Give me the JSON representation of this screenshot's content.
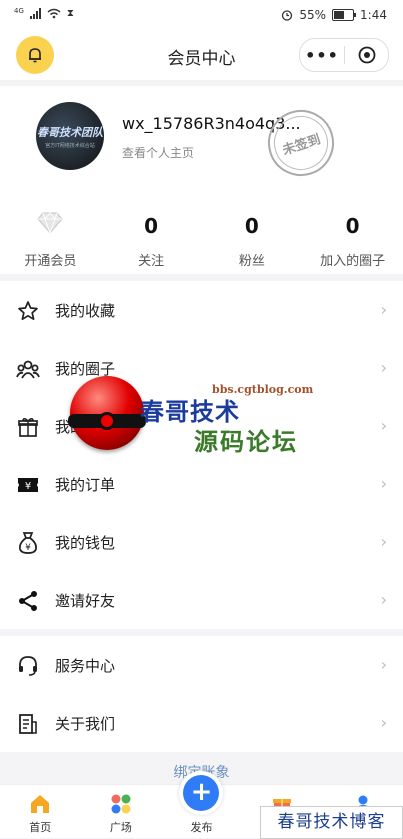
{
  "status_bar": {
    "network": "4G",
    "battery": "55%",
    "time": "1:44"
  },
  "nav": {
    "title": "会员中心",
    "more_label": "•••"
  },
  "profile": {
    "username": "wx_15786R3n4o4q3...",
    "view_profile": "查看个人主页",
    "avatar_text": "春哥技术团队",
    "avatar_subtext": "官方IT网络技术综合站",
    "checkin_stamp": "未签到"
  },
  "stats": [
    {
      "label": "开通会员"
    },
    {
      "value": "0",
      "label": "关注"
    },
    {
      "value": "0",
      "label": "粉丝"
    },
    {
      "value": "0",
      "label": "加入的圈子"
    }
  ],
  "menu_group1": [
    {
      "label": "我的收藏",
      "icon": "star-icon"
    },
    {
      "label": "我的圈子",
      "icon": "group-icon"
    },
    {
      "label": "我的礼物",
      "icon": "gift-icon"
    },
    {
      "label": "我的订单",
      "icon": "ticket-icon"
    },
    {
      "label": "我的钱包",
      "icon": "wallet-icon"
    },
    {
      "label": "邀请好友",
      "icon": "share-icon"
    }
  ],
  "menu_group2": [
    {
      "label": "服务中心",
      "icon": "headset-icon"
    },
    {
      "label": "关于我们",
      "icon": "document-icon"
    }
  ],
  "footer_note": "绑定账象",
  "tabbar": [
    {
      "label": "首页",
      "icon": "home-icon"
    },
    {
      "label": "广场",
      "icon": "grid-icon"
    },
    {
      "label": "发布",
      "icon": "plus-icon"
    },
    {
      "label": "",
      "icon": "gift-icon"
    },
    {
      "label": "",
      "icon": "user-icon"
    }
  ],
  "watermark": {
    "url": "bbs.cgtblog.com",
    "line1": "春哥技术",
    "line2": "源码论坛",
    "banner": "春哥技术博客"
  },
  "colors": {
    "accent_yellow": "#fbd24f",
    "publish_blue": "#2f7cf6"
  }
}
